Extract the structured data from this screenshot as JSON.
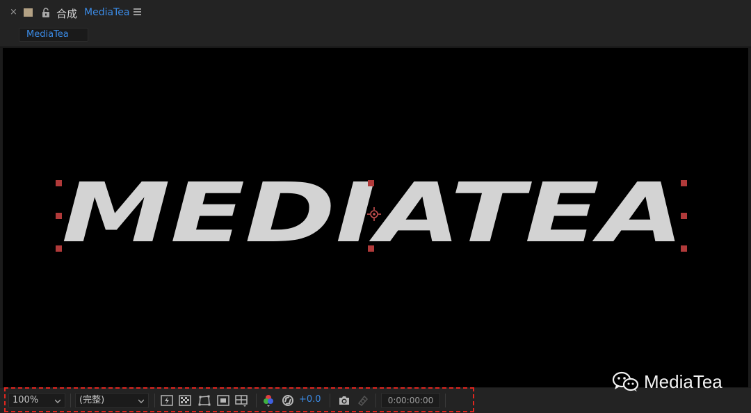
{
  "panel": {
    "close_glyph": "×",
    "title_label": "合成",
    "comp_name": "MediaTea",
    "tab_label": "MediaTea"
  },
  "viewer": {
    "layer_text": "MEDIATEA",
    "background": "#000000",
    "text_color": "#d3d3d3",
    "handle_color": "#b13a3a"
  },
  "toolbar": {
    "zoom_value": "100%",
    "resolution_value": "(完整)",
    "exposure_value": "+0.0",
    "timecode": "0:00:00:00"
  },
  "watermark": {
    "text": "MediaTea"
  },
  "colors": {
    "accent": "#3b8be6",
    "highlight_border": "#e0261f"
  }
}
